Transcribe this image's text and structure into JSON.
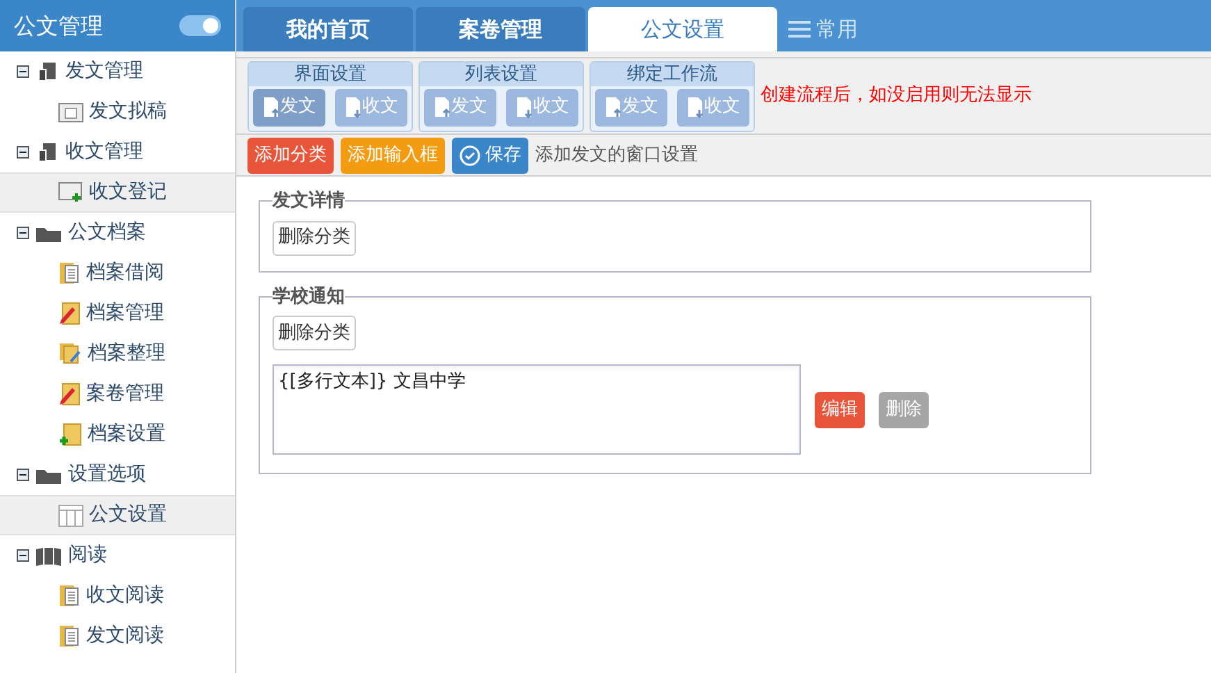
{
  "sidebar": {
    "title": "公文管理",
    "toggle": {
      "on": true
    },
    "tree": [
      {
        "label": "发文管理",
        "kind": "docs",
        "expanded": true,
        "children": [
          {
            "label": "发文拟稿",
            "kind": "window",
            "selected": false
          }
        ]
      },
      {
        "label": "收文管理",
        "kind": "docs",
        "expanded": true,
        "children": [
          {
            "label": "收文登记",
            "kind": "window-add",
            "selected": true
          }
        ]
      },
      {
        "label": "公文档案",
        "kind": "folder",
        "expanded": true,
        "children": [
          {
            "label": "档案借阅",
            "kind": "folder-doc",
            "selected": false
          },
          {
            "label": "档案管理",
            "kind": "folder-pencil",
            "selected": false
          },
          {
            "label": "档案整理",
            "kind": "folder-stack",
            "selected": false
          },
          {
            "label": "案卷管理",
            "kind": "folder-pencil",
            "selected": false
          },
          {
            "label": "档案设置",
            "kind": "folder-add",
            "selected": false
          }
        ]
      },
      {
        "label": "设置选项",
        "kind": "folder",
        "expanded": true,
        "children": [
          {
            "label": "公文设置",
            "kind": "table",
            "selected": true
          }
        ]
      },
      {
        "label": "阅读",
        "kind": "book",
        "expanded": true,
        "children": [
          {
            "label": "收文阅读",
            "kind": "folder-doc",
            "selected": false
          },
          {
            "label": "发文阅读",
            "kind": "folder-doc",
            "selected": false
          }
        ]
      }
    ]
  },
  "tabs": [
    {
      "label": "我的首页",
      "selected": false
    },
    {
      "label": "案卷管理",
      "selected": false
    },
    {
      "label": "公文设置",
      "selected": true
    }
  ],
  "menu": {
    "label": "常用"
  },
  "toolbar": {
    "groups": [
      {
        "title": "界面设置",
        "buttons": [
          {
            "label": "发文",
            "kind": "send",
            "selected": true
          },
          {
            "label": "收文",
            "kind": "receive",
            "selected": false
          }
        ]
      },
      {
        "title": "列表设置",
        "buttons": [
          {
            "label": "发文",
            "kind": "send",
            "selected": false
          },
          {
            "label": "收文",
            "kind": "receive",
            "selected": false
          }
        ]
      },
      {
        "title": "绑定工作流",
        "buttons": [
          {
            "label": "发文",
            "kind": "send",
            "selected": false
          },
          {
            "label": "收文",
            "kind": "receive",
            "selected": false
          }
        ]
      }
    ],
    "notice": "创建流程后，如没启用则无法显示"
  },
  "actions": {
    "buttons": [
      {
        "label": "添加分类",
        "kind": "red"
      },
      {
        "label": "添加输入框",
        "kind": "orange"
      },
      {
        "label": "保存",
        "kind": "save"
      }
    ],
    "hint": "添加发文的窗口设置"
  },
  "sections": [
    {
      "title": "发文详情",
      "delete_label": "删除分类"
    },
    {
      "title": "学校通知",
      "delete_label": "删除分类",
      "field": {
        "value": "{[多行文本]} 文昌中学",
        "edit_label": "编辑",
        "remove_label": "删除"
      }
    }
  ]
}
